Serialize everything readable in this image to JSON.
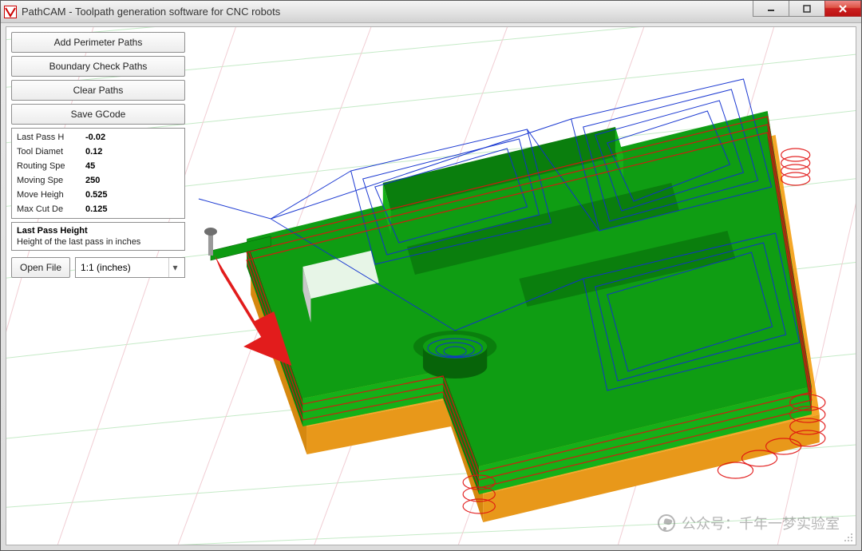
{
  "window": {
    "title": "PathCAM - Toolpath generation software for CNC robots"
  },
  "toolbar": {
    "add_perimeter_paths": "Add Perimeter Paths",
    "boundary_check_paths": "Boundary Check Paths",
    "clear_paths": "Clear Paths",
    "save_gcode": "Save GCode"
  },
  "properties": [
    {
      "label": "Last Pass H",
      "value": "-0.02"
    },
    {
      "label": "Tool Diamet",
      "value": "0.12"
    },
    {
      "label": "Routing Spe",
      "value": "45"
    },
    {
      "label": "Moving Spe",
      "value": "250"
    },
    {
      "label": "Move Heigh",
      "value": "0.525"
    },
    {
      "label": "Max Cut De",
      "value": "0.125"
    }
  ],
  "description": {
    "title": "Last Pass Height",
    "body": "Height of the last pass in inches"
  },
  "file": {
    "open_label": "Open File",
    "scale_selected": "1:1 (inches)"
  },
  "watermark": {
    "text": "公众号：千年一梦实验室"
  },
  "colors": {
    "model_top": "#0f9d13",
    "model_side_light": "#15b018",
    "model_side_dark": "#0a7e0d",
    "stock": "#f4a21b",
    "toolpath": "#1030d0",
    "perimeter": "#e01010",
    "arrow": "#e21c1c",
    "grid_h": "#bfe8c1",
    "grid_v": "#f0c8cf"
  }
}
